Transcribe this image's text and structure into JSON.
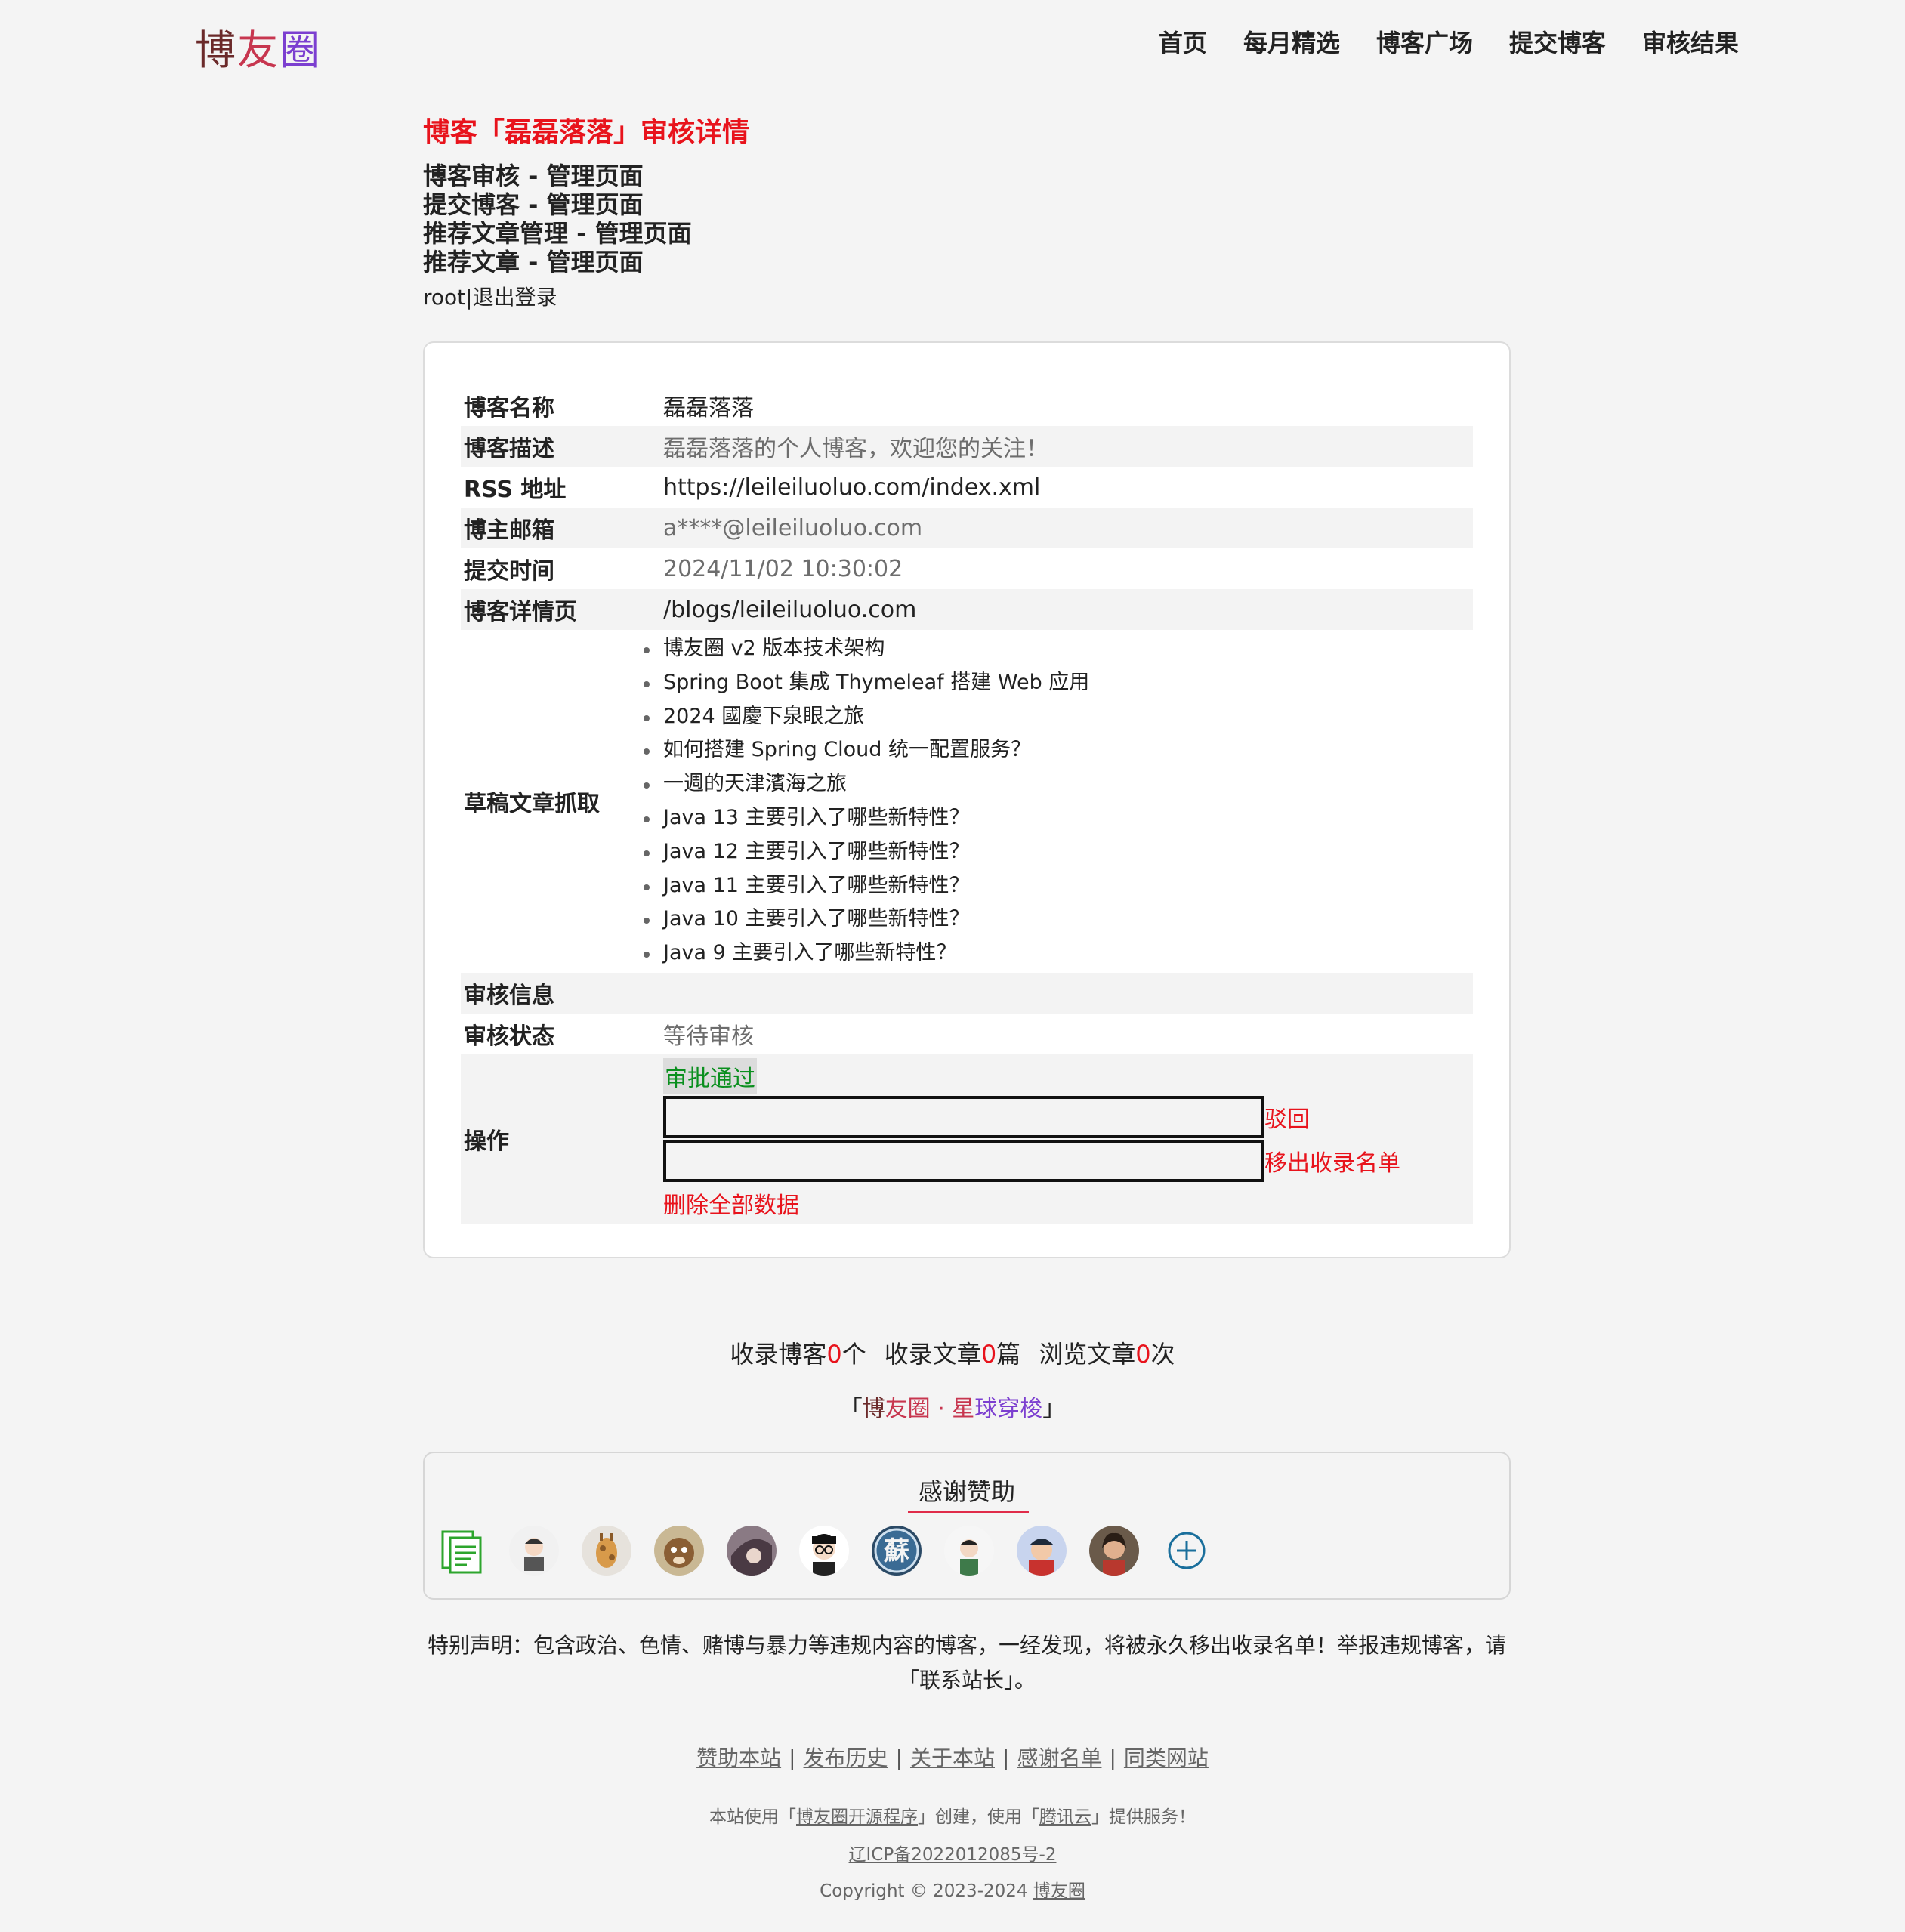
{
  "header": {
    "logo": [
      "博",
      "友",
      "圈"
    ],
    "nav": [
      "首页",
      "每月精选",
      "博客广场",
      "提交博客",
      "审核结果"
    ]
  },
  "page_title": "博客「磊磊落落」审核详情",
  "admin_links": [
    "博客审核 - 管理页面",
    "提交博客 - 管理页面",
    "推荐文章管理 - 管理页面",
    "推荐文章 - 管理页面"
  ],
  "user": {
    "name": "root",
    "separator": "|",
    "logout": "退出登录"
  },
  "details": {
    "blog_name": {
      "label": "博客名称",
      "value": "磊磊落落"
    },
    "description": {
      "label": "博客描述",
      "value": "磊磊落落的个人博客，欢迎您的关注！"
    },
    "rss": {
      "label": "RSS 地址",
      "value": "https://leileiluoluo.com/index.xml"
    },
    "email": {
      "label": "博主邮箱",
      "value": "a****@leileiluoluo.com"
    },
    "submit_time": {
      "label": "提交时间",
      "value": "2024/11/02 10:30:02"
    },
    "detail_page": {
      "label": "博客详情页",
      "value": "/blogs/leileiluoluo.com"
    },
    "drafts": {
      "label": "草稿文章抓取",
      "items": [
        "博友圈 v2 版本技术架构",
        "Spring Boot 集成 Thymeleaf 搭建 Web 应用",
        "2024 國慶下泉眼之旅",
        "如何搭建 Spring Cloud 统一配置服务？",
        "一週的天津濱海之旅",
        "Java 13 主要引入了哪些新特性？",
        "Java 12 主要引入了哪些新特性？",
        "Java 11 主要引入了哪些新特性？",
        "Java 10 主要引入了哪些新特性？",
        "Java 9 主要引入了哪些新特性？"
      ]
    },
    "review_info": {
      "label": "审核信息",
      "value": ""
    },
    "review_status": {
      "label": "审核状态",
      "value": "等待审核"
    },
    "operations": {
      "label": "操作",
      "approve": "审批通过",
      "reject": "驳回",
      "remove": "移出收录名单",
      "delete_all": "删除全部数据"
    }
  },
  "stats": {
    "blogs_label": "收录博客",
    "blogs_count": "0",
    "blogs_unit": "个",
    "articles_label": "收录文章",
    "articles_count": "0",
    "articles_unit": "篇",
    "views_label": "浏览文章",
    "views_count": "0",
    "views_unit": "次"
  },
  "slogan": {
    "open": "「",
    "p1": "博",
    "p2": "友圈 · 星",
    "p3": "球穿梭",
    "close": "」"
  },
  "sponsors": {
    "title": "感谢赞助",
    "avatars": [
      "document-icon",
      "avatar-1",
      "avatar-2",
      "avatar-3",
      "avatar-4",
      "avatar-5",
      "avatar-6",
      "avatar-7",
      "avatar-8",
      "avatar-9",
      "add-circle-icon"
    ],
    "avatar_text": "蘇"
  },
  "notice": "特别声明：包含政治、色情、赌博与暴力等违规内容的博客，一经发现，将被永久移出收录名单！举报违规博客，请「联系站长」。",
  "footer": {
    "links": [
      "赞助本站",
      "发布历史",
      "关于本站",
      "感谢名单",
      "同类网站"
    ],
    "sep": "|",
    "powered_prefix": "本站使用「",
    "powered_link": "博友圈开源程序",
    "powered_mid": "」创建，使用「",
    "cloud_link": "腾讯云",
    "powered_suffix": "」提供服务！",
    "icp": "辽ICP备2022012085号-2",
    "copyright_prefix": "Copyright © 2023-2024 ",
    "copyright_link": "博友圈"
  },
  "colors": {
    "accent_red": "#e8131c",
    "approve_green": "#0a8f1e",
    "underline_pink": "#e02c4a"
  }
}
